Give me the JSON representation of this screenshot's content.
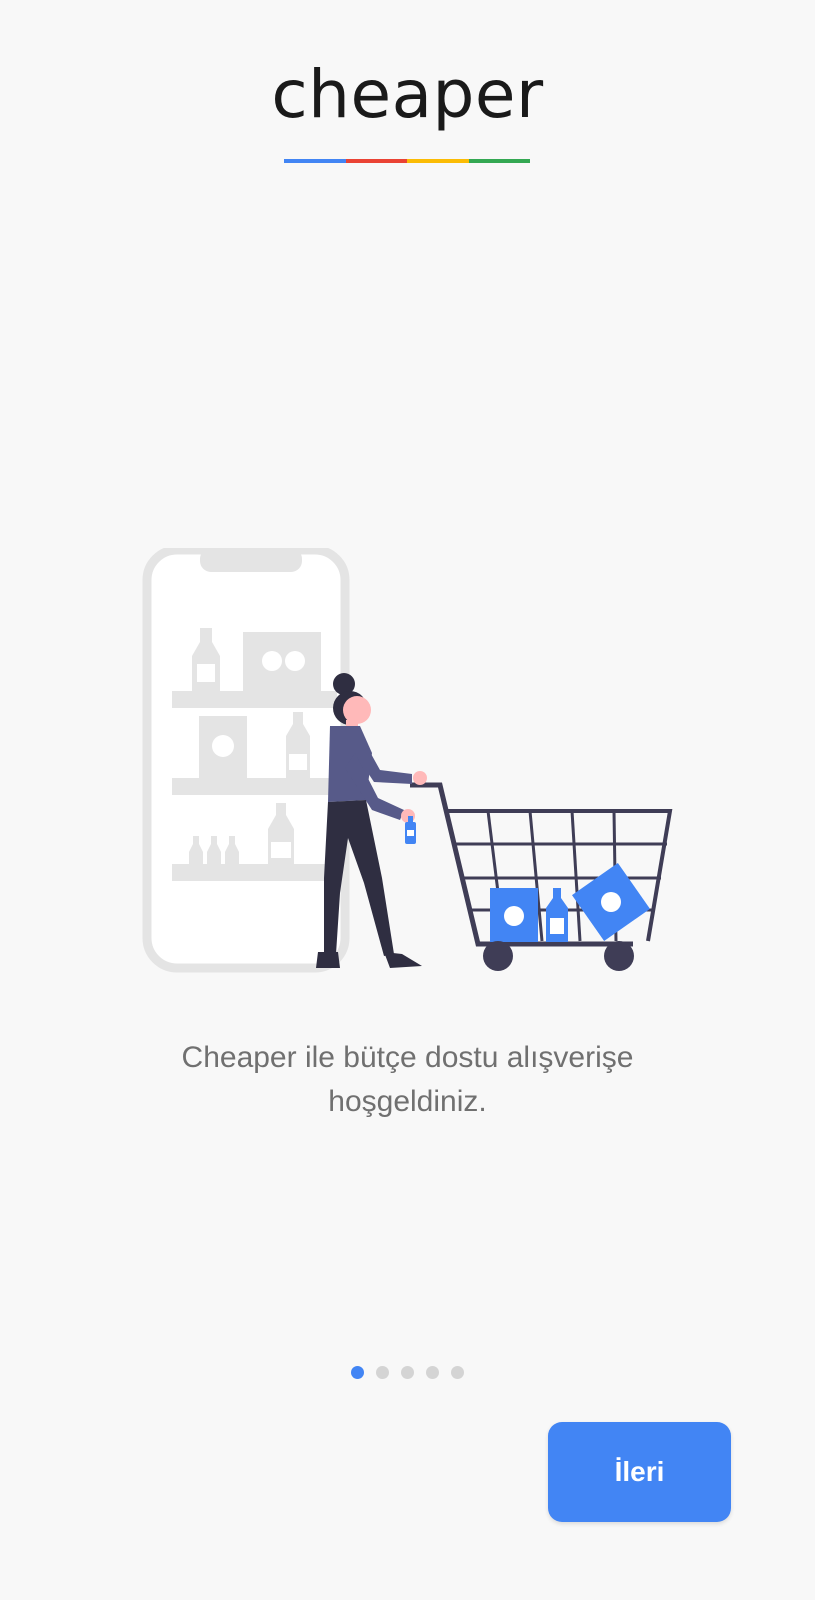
{
  "logo": {
    "text": "cheaper",
    "underline_colors": [
      "#4285f4",
      "#ea4335",
      "#fbbc05",
      "#34a853"
    ]
  },
  "onboarding": {
    "message": "Cheaper ile bütçe dostu alışverişe hoşgeldiniz.",
    "page_indicator": {
      "total": 5,
      "active_index": 0
    }
  },
  "actions": {
    "next_label": "İleri"
  },
  "colors": {
    "accent": "#4285f4",
    "background": "#f8f8f8",
    "text_secondary": "#707070"
  }
}
